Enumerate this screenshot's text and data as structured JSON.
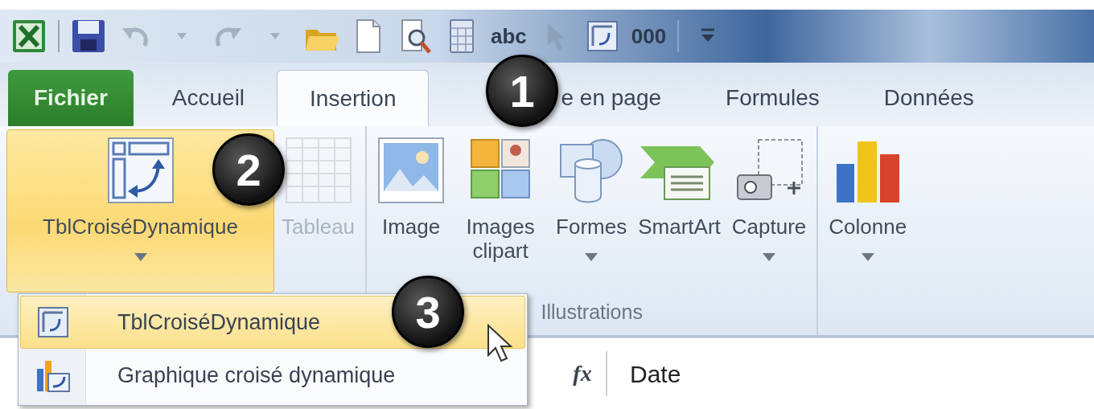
{
  "quick_access": [
    {
      "kind": "logo",
      "disabled": false
    },
    {
      "kind": "separator"
    },
    {
      "kind": "save",
      "disabled": false
    },
    {
      "kind": "undo",
      "disabled": true
    },
    {
      "kind": "caret",
      "disabled": true
    },
    {
      "kind": "redo",
      "disabled": true
    },
    {
      "kind": "caret",
      "disabled": true
    },
    {
      "kind": "open",
      "disabled": false
    },
    {
      "kind": "new",
      "disabled": false
    },
    {
      "kind": "preview",
      "disabled": false
    },
    {
      "kind": "calc",
      "disabled": false
    },
    {
      "kind": "text",
      "text": "abc",
      "disabled": false
    },
    {
      "kind": "pointer",
      "disabled": true
    },
    {
      "kind": "sheet",
      "disabled": false
    },
    {
      "kind": "text",
      "text": "000",
      "disabled": false
    },
    {
      "kind": "separator"
    },
    {
      "kind": "customize",
      "disabled": false
    }
  ],
  "tabs": [
    {
      "label": "Fichier",
      "kind": "file",
      "selected": false
    },
    {
      "label": "Accueil",
      "kind": "tab",
      "selected": false
    },
    {
      "label": "Insertion",
      "kind": "tab",
      "selected": true
    },
    {
      "label": "e en page",
      "kind": "tab",
      "selected": false
    },
    {
      "label": "Formules",
      "kind": "tab",
      "selected": false
    },
    {
      "label": "Données",
      "kind": "tab",
      "selected": false
    }
  ],
  "ribbon": {
    "groups": [
      {
        "buttons": [
          {
            "label": "TblCroiséDynamique",
            "kind": "pivot",
            "dropdown": true,
            "highlighted": true,
            "disabled": false
          },
          {
            "label": "Tableau",
            "kind": "table",
            "dropdown": false,
            "highlighted": false,
            "disabled": true
          }
        ]
      },
      {
        "label": "Illustrations",
        "buttons": [
          {
            "label": "Image",
            "kind": "image",
            "dropdown": false,
            "highlighted": false,
            "disabled": false
          },
          {
            "label": "Images clipart",
            "kind": "clipart",
            "dropdown": false,
            "highlighted": false,
            "disabled": false
          },
          {
            "label": "Formes",
            "kind": "shapes",
            "dropdown": true,
            "highlighted": false,
            "disabled": false
          },
          {
            "label": "SmartArt",
            "kind": "smartart",
            "dropdown": false,
            "highlighted": false,
            "disabled": false
          },
          {
            "label": "Capture",
            "kind": "capture",
            "dropdown": true,
            "highlighted": false,
            "disabled": false
          }
        ]
      },
      {
        "buttons": [
          {
            "label": "Colonne",
            "kind": "column",
            "dropdown": true,
            "highlighted": false,
            "disabled": false
          }
        ]
      }
    ]
  },
  "menu": {
    "items": [
      {
        "label": "TblCroiséDynamique",
        "kind": "pivot",
        "highlighted": true
      },
      {
        "label": "Graphique croisé dynamique",
        "kind": "chart",
        "highlighted": false
      }
    ]
  },
  "formula_bar": {
    "function_label": "fx",
    "value": "Date"
  },
  "callouts": [
    "1",
    "2",
    "3"
  ]
}
